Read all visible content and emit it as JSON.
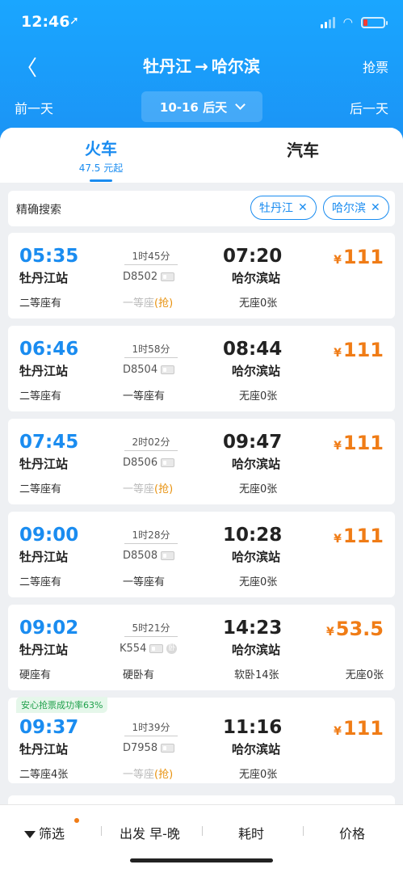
{
  "status": {
    "time": "12:46",
    "arrow": "➚",
    "wifi": "◠"
  },
  "nav": {
    "back": "〈",
    "from": "牡丹江",
    "arrow": "→",
    "to": "哈尔滨",
    "grab": "抢票"
  },
  "date": {
    "prev": "前一天",
    "current": "10-16 后天",
    "next": "后一天"
  },
  "tabs": {
    "train": "火车",
    "train_price": "47.5 元起",
    "bus": "汽车"
  },
  "filter": {
    "label": "精确搜索",
    "chips": [
      "牡丹江",
      "哈尔滨"
    ],
    "close": "✕"
  },
  "trains": [
    {
      "dep": "05:35",
      "dep_station": "牡丹江站",
      "duration": "1时45分",
      "no": "D8502",
      "arr": "07:20",
      "arr_station": "哈尔滨站",
      "yen": "¥",
      "price": "111",
      "seat1": "二等座有",
      "seat2_text": "一等座",
      "seat2_grab": "(抢)",
      "seat3": "无座0张"
    },
    {
      "dep": "06:46",
      "dep_station": "牡丹江站",
      "duration": "1时58分",
      "no": "D8504",
      "arr": "08:44",
      "arr_station": "哈尔滨站",
      "yen": "¥",
      "price": "111",
      "seat1": "二等座有",
      "seat2_text": "一等座有",
      "seat2_grab": "",
      "seat3": "无座0张"
    },
    {
      "dep": "07:45",
      "dep_station": "牡丹江站",
      "duration": "2时02分",
      "no": "D8506",
      "arr": "09:47",
      "arr_station": "哈尔滨站",
      "yen": "¥",
      "price": "111",
      "seat1": "二等座有",
      "seat2_text": "一等座",
      "seat2_grab": "(抢)",
      "seat3": "无座0张"
    },
    {
      "dep": "09:00",
      "dep_station": "牡丹江站",
      "duration": "1时28分",
      "no": "D8508",
      "arr": "10:28",
      "arr_station": "哈尔滨站",
      "yen": "¥",
      "price": "111",
      "seat1": "二等座有",
      "seat2_text": "一等座有",
      "seat2_grab": "",
      "seat3": "无座0张"
    },
    {
      "dep": "09:02",
      "dep_station": "牡丹江站",
      "duration": "5时21分",
      "no": "K554",
      "sleep": "卧",
      "arr": "14:23",
      "arr_station": "哈尔滨站",
      "yen": "¥",
      "price": "53.5",
      "seat1": "硬座有",
      "seat2_text": "硬卧有",
      "seat2_grab": "",
      "seat3": "软卧14张",
      "seat4": "无座0张"
    },
    {
      "dep": "09:37",
      "dep_station": "牡丹江站",
      "duration": "1时39分",
      "no": "D7958",
      "arr": "11:16",
      "arr_station": "哈尔滨站",
      "yen": "¥",
      "price": "111",
      "seat1": "二等座4张",
      "seat2_text": "一等座",
      "seat2_grab": "(抢)",
      "seat3": "无座0张",
      "badge": "安心抢票成功率63%"
    }
  ],
  "bottom": {
    "filter": "筛选",
    "depart": "出发 早-晚",
    "duration": "耗时",
    "price": "价格"
  }
}
